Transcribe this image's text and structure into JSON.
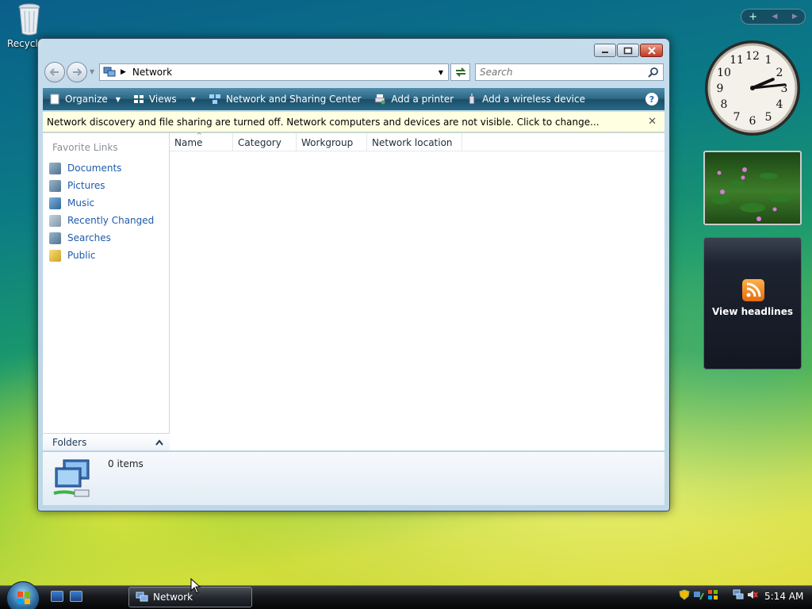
{
  "desktop": {
    "recycle_bin_label": "Recycle"
  },
  "window": {
    "address": "Network",
    "search_placeholder": "Search",
    "commands": [
      {
        "label": "Organize"
      },
      {
        "label": "Views"
      },
      {
        "label": "Network and Sharing Center"
      },
      {
        "label": "Add a printer"
      },
      {
        "label": "Add a wireless device"
      }
    ],
    "infobar_text": "Network discovery and file sharing are turned off. Network computers and devices are not visible. Click to change...",
    "favorite_links_title": "Favorite Links",
    "favorite_links": [
      {
        "label": "Documents"
      },
      {
        "label": "Pictures"
      },
      {
        "label": "Music"
      },
      {
        "label": "Recently Changed"
      },
      {
        "label": "Searches"
      },
      {
        "label": "Public"
      }
    ],
    "folders_label": "Folders",
    "columns": [
      "Name",
      "Category",
      "Workgroup",
      "Network location"
    ],
    "item_count": "0 items"
  },
  "gadgets": {
    "feeds_label": "View headlines",
    "clock": {
      "hour": 2,
      "minute": 14
    }
  },
  "taskbar": {
    "task_label": "Network",
    "time": "5:14 AM"
  },
  "colors": {
    "link": "#1d5aab",
    "infobar_bg": "#ffffe1",
    "cmdbar": "#2d6683"
  }
}
